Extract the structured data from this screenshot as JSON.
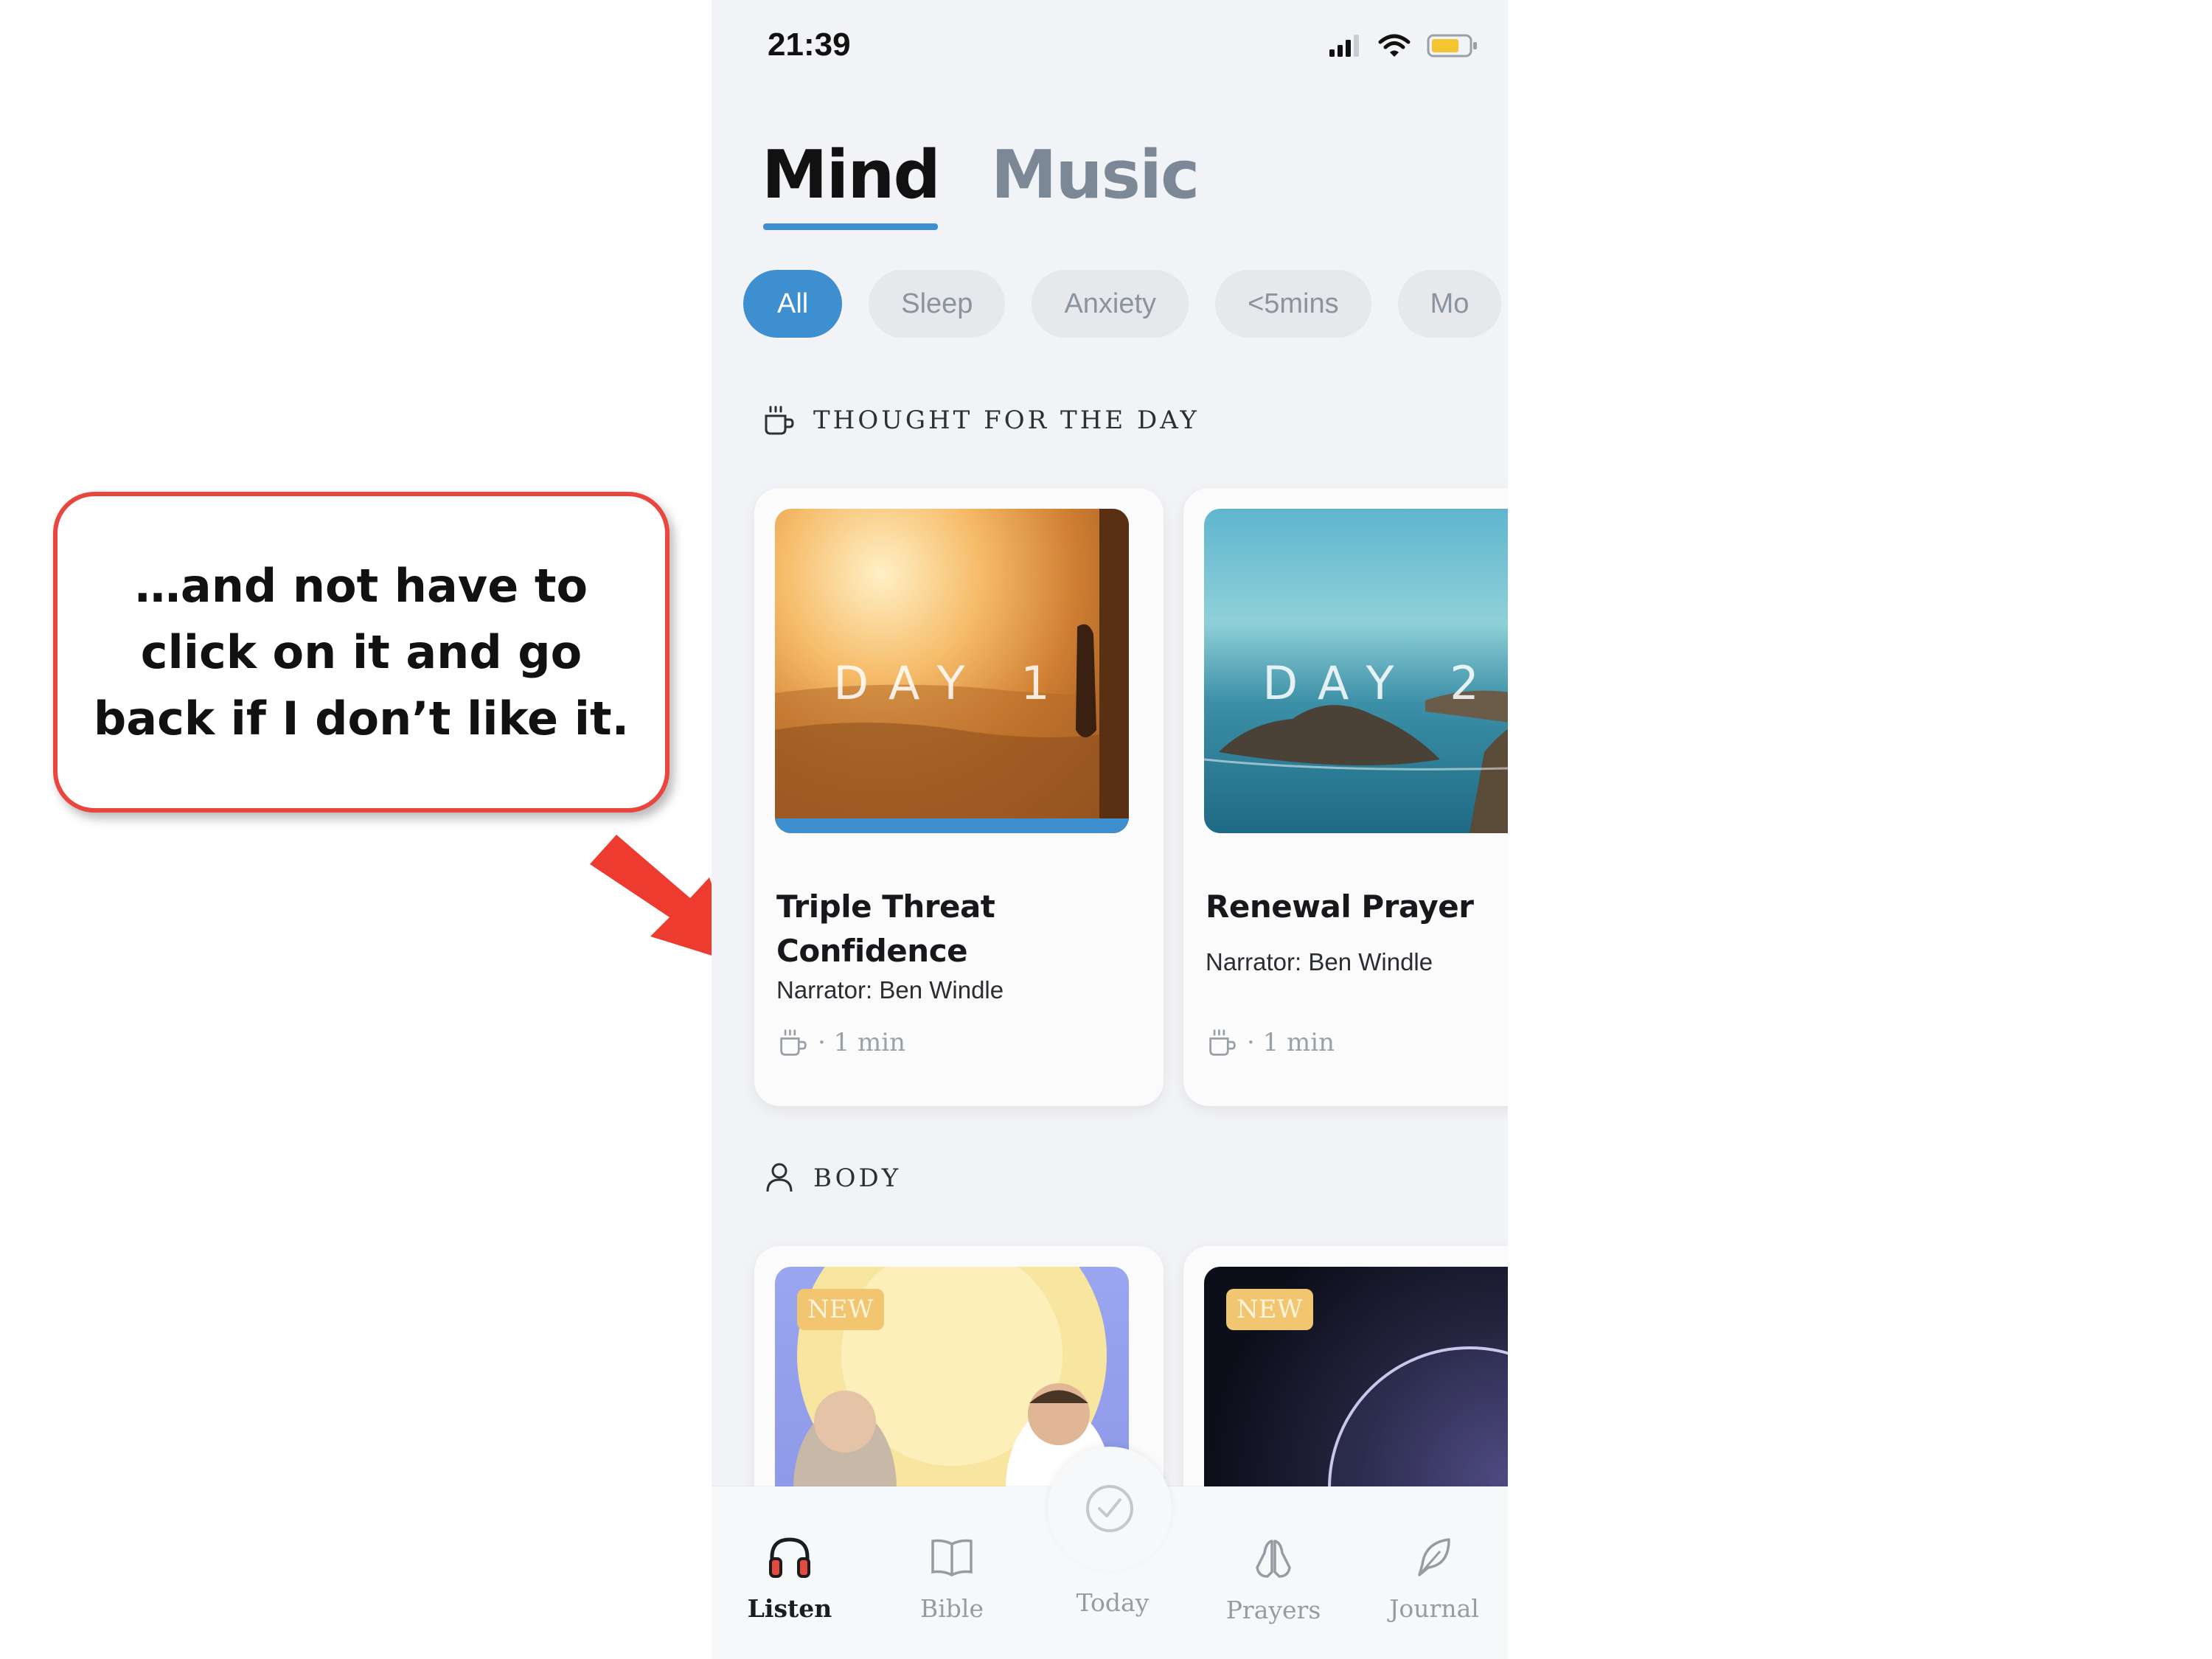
{
  "callout": {
    "text": "…and not have to click on it and go back if I don’t like it.",
    "border_color": "#e8463f",
    "arrow_color": "#ee3b30"
  },
  "status_bar": {
    "time": "21:39",
    "icons": [
      "cellular-signal-icon",
      "wifi-icon",
      "battery-icon"
    ]
  },
  "segments": [
    {
      "label": "Mind",
      "selected": true
    },
    {
      "label": "Music",
      "selected": false
    }
  ],
  "filter_chips": [
    {
      "label": "All",
      "selected": true
    },
    {
      "label": "Sleep",
      "selected": false
    },
    {
      "label": "Anxiety",
      "selected": false
    },
    {
      "label": "<5mins",
      "selected": false
    },
    {
      "label": "Mo",
      "selected": false
    }
  ],
  "sections": [
    {
      "title": "THOUGHT FOR THE DAY",
      "icon": "coffee-cup-icon",
      "cards": [
        {
          "day_label": "DAY 1",
          "title": "Triple Threat Confidence",
          "narrator": "Narrator: Ben Windle",
          "meta_icon": "coffee-cup-icon",
          "duration": "· 1 min",
          "progress": 1.0
        },
        {
          "day_label": "DAY 2",
          "title": "Renewal Prayer",
          "narrator": "Narrator: Ben Windle",
          "meta_icon": "coffee-cup-icon",
          "duration": "· 1 min",
          "progress": 0
        }
      ]
    },
    {
      "title": "BODY",
      "icon": "person-icon",
      "cards": [
        {
          "badge": "NEW"
        },
        {
          "badge": "NEW"
        }
      ]
    }
  ],
  "tab_bar": [
    {
      "label": "Listen",
      "icon": "headphones-icon",
      "selected": true
    },
    {
      "label": "Bible",
      "icon": "book-icon",
      "selected": false
    },
    {
      "label": "Today",
      "icon": "check-circle-icon",
      "selected": false
    },
    {
      "label": "Prayers",
      "icon": "praying-hands-icon",
      "selected": false
    },
    {
      "label": "Journal",
      "icon": "feather-pen-icon",
      "selected": false
    }
  ],
  "colors": {
    "accent": "#3e8fd0",
    "app_background": "#f2f3f6",
    "badge": "#f2c570"
  }
}
